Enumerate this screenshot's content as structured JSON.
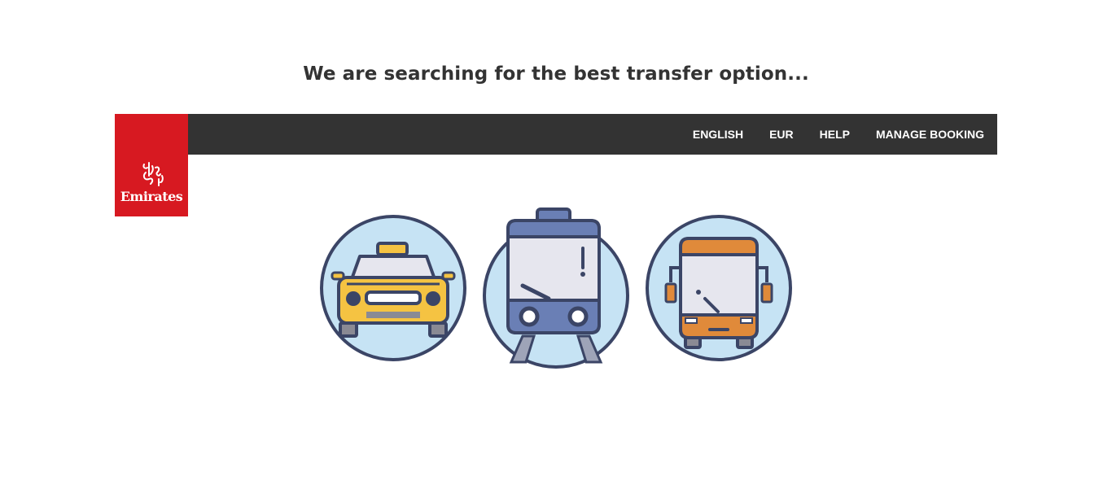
{
  "loading": {
    "title": "We are searching for the best transfer option..."
  },
  "brand": {
    "logo_text": "Emirates",
    "color": "#d71921"
  },
  "nav": {
    "items": [
      {
        "label": "ENGLISH"
      },
      {
        "label": "EUR"
      },
      {
        "label": "HELP"
      },
      {
        "label": "MANAGE BOOKING"
      }
    ]
  },
  "transport_icons": [
    "taxi-icon",
    "tram-icon",
    "bus-icon"
  ],
  "colors": {
    "header_bg": "#333333",
    "outline": "#3b4566",
    "circle_fill": "#c6e3f4",
    "taxi": "#f5c342",
    "tram": "#6a7fb5",
    "bus": "#e08a3a"
  }
}
